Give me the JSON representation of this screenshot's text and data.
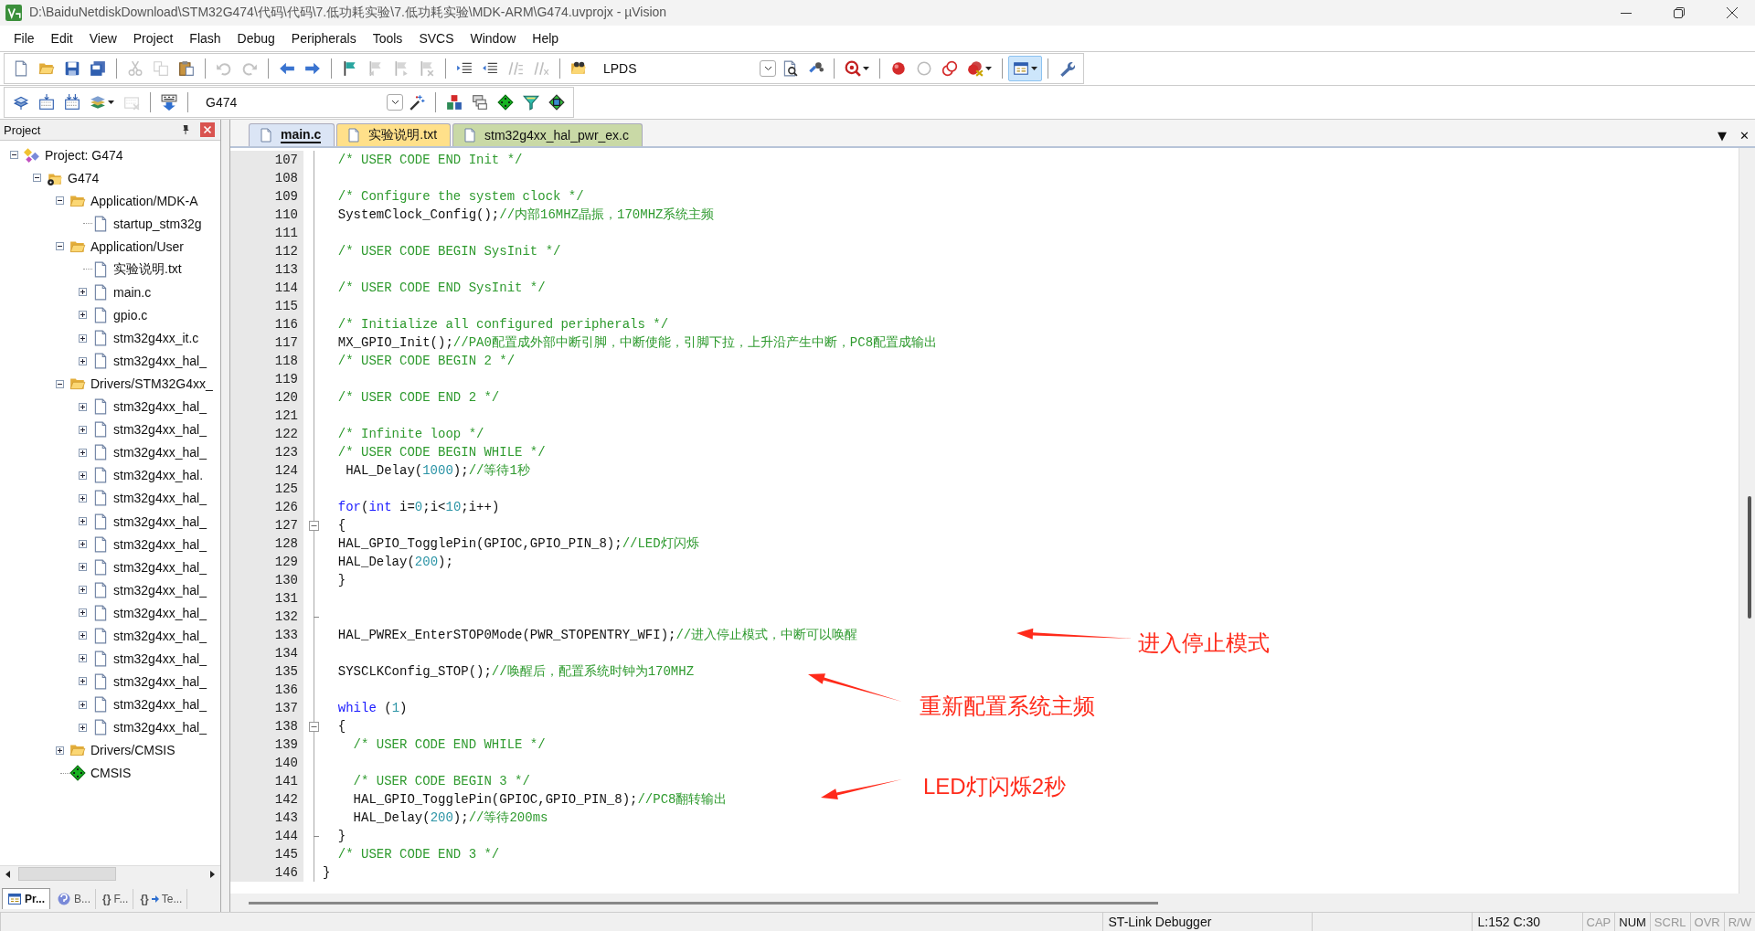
{
  "window": {
    "title": "D:\\BaiduNetdiskDownload\\STM32G474\\代码\\代码\\7.低功耗实验\\7.低功耗实验\\MDK-ARM\\G474.uvprojx - µVision"
  },
  "menu": [
    "File",
    "Edit",
    "View",
    "Project",
    "Flash",
    "Debug",
    "Peripherals",
    "Tools",
    "SVCS",
    "Window",
    "Help"
  ],
  "toolbar_1": [
    {
      "kind": "button",
      "disabled": false,
      "pressed": false
    },
    {
      "kind": "button",
      "disabled": false,
      "pressed": false
    },
    {
      "kind": "button",
      "disabled": false,
      "pressed": false
    },
    {
      "kind": "button",
      "disabled": false,
      "pressed": false
    },
    {
      "kind": "separator"
    },
    {
      "kind": "button",
      "disabled": true,
      "pressed": false
    },
    {
      "kind": "button",
      "disabled": true,
      "pressed": false
    },
    {
      "kind": "button",
      "disabled": false,
      "pressed": false
    },
    {
      "kind": "separator"
    },
    {
      "kind": "button",
      "disabled": true,
      "pressed": false
    },
    {
      "kind": "button",
      "disabled": true,
      "pressed": false
    },
    {
      "kind": "separator"
    },
    {
      "kind": "button",
      "disabled": false,
      "pressed": false
    },
    {
      "kind": "button",
      "disabled": false,
      "pressed": false
    },
    {
      "kind": "separator"
    },
    {
      "kind": "button",
      "disabled": false,
      "pressed": false
    },
    {
      "kind": "button",
      "disabled": true,
      "pressed": false
    },
    {
      "kind": "button",
      "disabled": true,
      "pressed": false
    },
    {
      "kind": "button",
      "disabled": true,
      "pressed": false
    },
    {
      "kind": "separator"
    },
    {
      "kind": "button",
      "disabled": false,
      "pressed": false
    },
    {
      "kind": "button",
      "disabled": false,
      "pressed": false
    },
    {
      "kind": "button",
      "disabled": true,
      "pressed": false
    },
    {
      "kind": "button",
      "disabled": true,
      "pressed": false
    },
    {
      "kind": "separator"
    },
    {
      "kind": "button",
      "disabled": false,
      "pressed": false
    },
    {
      "kind": "combo",
      "value": "LPDS"
    },
    {
      "kind": "button",
      "disabled": false,
      "pressed": false
    },
    {
      "kind": "button",
      "disabled": false,
      "pressed": false
    },
    {
      "kind": "separator"
    },
    {
      "kind": "button",
      "disabled": false,
      "pressed": false
    },
    {
      "kind": "separator"
    },
    {
      "kind": "button",
      "disabled": false,
      "pressed": false
    },
    {
      "kind": "button",
      "disabled": false,
      "pressed": false
    },
    {
      "kind": "button",
      "disabled": false,
      "pressed": false
    },
    {
      "kind": "button",
      "disabled": false,
      "pressed": false
    },
    {
      "kind": "separator"
    },
    {
      "kind": "button",
      "disabled": false,
      "pressed": true
    },
    {
      "kind": "separator"
    },
    {
      "kind": "button",
      "disabled": false,
      "pressed": false
    }
  ],
  "toolbar_2": [
    {
      "kind": "button",
      "disabled": false,
      "pressed": false
    },
    {
      "kind": "button",
      "disabled": false,
      "pressed": false
    },
    {
      "kind": "button",
      "disabled": false,
      "pressed": false
    },
    {
      "kind": "button",
      "disabled": false,
      "pressed": false
    },
    {
      "kind": "button",
      "disabled": true,
      "pressed": false
    },
    {
      "kind": "separator"
    },
    {
      "kind": "button",
      "disabled": false,
      "pressed": false
    },
    {
      "kind": "separator"
    },
    {
      "kind": "combo",
      "value": "G474"
    },
    {
      "kind": "button",
      "disabled": false,
      "pressed": false
    },
    {
      "kind": "separator"
    },
    {
      "kind": "button",
      "disabled": false,
      "pressed": false
    },
    {
      "kind": "button",
      "disabled": false,
      "pressed": false
    },
    {
      "kind": "button",
      "disabled": false,
      "pressed": false
    },
    {
      "kind": "button",
      "disabled": false,
      "pressed": false
    },
    {
      "kind": "button",
      "disabled": false,
      "pressed": false
    }
  ],
  "project_panel": {
    "title": "Project",
    "tree": [
      {
        "label": "Project: G474",
        "kind": "project",
        "expanded": true,
        "children": [
          {
            "label": "G474",
            "kind": "target",
            "expanded": true,
            "children": [
              {
                "label": "Application/MDK-A",
                "kind": "group",
                "expanded": true,
                "children": [
                  {
                    "label": "startup_stm32g",
                    "kind": "file"
                  }
                ]
              },
              {
                "label": "Application/User",
                "kind": "group",
                "expanded": true,
                "children": [
                  {
                    "label": "实验说明.txt",
                    "kind": "file"
                  },
                  {
                    "label": "main.c",
                    "kind": "file",
                    "expanded": false
                  },
                  {
                    "label": "gpio.c",
                    "kind": "file",
                    "expanded": false
                  },
                  {
                    "label": "stm32g4xx_it.c",
                    "kind": "file",
                    "expanded": false
                  },
                  {
                    "label": "stm32g4xx_hal_",
                    "kind": "file",
                    "expanded": false
                  }
                ]
              },
              {
                "label": "Drivers/STM32G4xx_",
                "kind": "group",
                "expanded": true,
                "children": [
                  {
                    "label": "stm32g4xx_hal_",
                    "kind": "file",
                    "expanded": false
                  },
                  {
                    "label": "stm32g4xx_hal_",
                    "kind": "file",
                    "expanded": false
                  },
                  {
                    "label": "stm32g4xx_hal_",
                    "kind": "file",
                    "expanded": false
                  },
                  {
                    "label": "stm32g4xx_hal.",
                    "kind": "file",
                    "expanded": false
                  },
                  {
                    "label": "stm32g4xx_hal_",
                    "kind": "file",
                    "expanded": false
                  },
                  {
                    "label": "stm32g4xx_hal_",
                    "kind": "file",
                    "expanded": false
                  },
                  {
                    "label": "stm32g4xx_hal_",
                    "kind": "file",
                    "expanded": false
                  },
                  {
                    "label": "stm32g4xx_hal_",
                    "kind": "file",
                    "expanded": false
                  },
                  {
                    "label": "stm32g4xx_hal_",
                    "kind": "file",
                    "expanded": false
                  },
                  {
                    "label": "stm32g4xx_hal_",
                    "kind": "file",
                    "expanded": false
                  },
                  {
                    "label": "stm32g4xx_hal_",
                    "kind": "file",
                    "expanded": false
                  },
                  {
                    "label": "stm32g4xx_hal_",
                    "kind": "file",
                    "expanded": false
                  },
                  {
                    "label": "stm32g4xx_hal_",
                    "kind": "file",
                    "expanded": false
                  },
                  {
                    "label": "stm32g4xx_hal_",
                    "kind": "file",
                    "expanded": false
                  },
                  {
                    "label": "stm32g4xx_hal_",
                    "kind": "file",
                    "expanded": false
                  }
                ]
              },
              {
                "label": "Drivers/CMSIS",
                "kind": "group",
                "expanded": false
              },
              {
                "label": "CMSIS",
                "kind": "component"
              }
            ]
          }
        ]
      }
    ],
    "tabs": [
      {
        "label": "Pr...",
        "selected": true
      },
      {
        "label": "B...",
        "selected": false
      },
      {
        "label": "F...",
        "glyph": "{}",
        "selected": false
      },
      {
        "label": "Te...",
        "glyph": "{}",
        "selected": false
      }
    ]
  },
  "editor": {
    "tabs": [
      {
        "label": "main.c",
        "selected": true,
        "color": "#dbe5f5"
      },
      {
        "label": "实验说明.txt",
        "selected": false,
        "color": "#ffe08a"
      },
      {
        "label": "stm32g4xx_hal_pwr_ex.c",
        "selected": false,
        "color": "#c9d9a6"
      }
    ],
    "tab_menu": "▼",
    "close": "✕",
    "lines": [
      {
        "number": "107",
        "kind": "line",
        "segments": [
          {
            "kind": "comment",
            "text": "  /* USER CODE END Init */"
          }
        ]
      },
      {
        "number": "108",
        "kind": "line"
      },
      {
        "number": "109",
        "kind": "line",
        "segments": [
          {
            "kind": "comment",
            "text": "  /* Configure the system clock */"
          }
        ]
      },
      {
        "number": "110",
        "kind": "line",
        "segments": [
          {
            "kind": "plain",
            "text": "  SystemClock_Config();"
          },
          {
            "kind": "comment",
            "text": "//内部16MHZ晶振，170MHZ系统主频"
          }
        ]
      },
      {
        "number": "111",
        "kind": "line"
      },
      {
        "number": "112",
        "kind": "line",
        "segments": [
          {
            "kind": "comment",
            "text": "  /* USER CODE BEGIN SysInit */"
          }
        ]
      },
      {
        "number": "113",
        "kind": "line"
      },
      {
        "number": "114",
        "kind": "line",
        "segments": [
          {
            "kind": "comment",
            "text": "  /* USER CODE END SysInit */"
          }
        ]
      },
      {
        "number": "115",
        "kind": "line"
      },
      {
        "number": "116",
        "kind": "line",
        "segments": [
          {
            "kind": "comment",
            "text": "  /* Initialize all configured peripherals */"
          }
        ]
      },
      {
        "number": "117",
        "kind": "line",
        "segments": [
          {
            "kind": "plain",
            "text": "  MX_GPIO_Init();"
          },
          {
            "kind": "comment",
            "text": "//PA0配置成外部中断引脚，中断使能，引脚下拉，上升沿产生中断，PC8配置成输出"
          }
        ]
      },
      {
        "number": "118",
        "kind": "line",
        "segments": [
          {
            "kind": "comment",
            "text": "  /* USER CODE BEGIN 2 */"
          }
        ]
      },
      {
        "number": "119",
        "kind": "line"
      },
      {
        "number": "120",
        "kind": "line",
        "segments": [
          {
            "kind": "comment",
            "text": "  /* USER CODE END 2 */"
          }
        ]
      },
      {
        "number": "121",
        "kind": "line"
      },
      {
        "number": "122",
        "kind": "line",
        "segments": [
          {
            "kind": "comment",
            "text": "  /* Infinite loop */"
          }
        ]
      },
      {
        "number": "123",
        "kind": "line",
        "segments": [
          {
            "kind": "comment",
            "text": "  /* USER CODE BEGIN WHILE */"
          }
        ]
      },
      {
        "number": "124",
        "kind": "line",
        "segments": [
          {
            "kind": "plain",
            "text": "   HAL_Delay("
          },
          {
            "kind": "number",
            "text": "1000"
          },
          {
            "kind": "plain",
            "text": ");"
          },
          {
            "kind": "comment",
            "text": "//等待1秒"
          }
        ]
      },
      {
        "number": "125",
        "kind": "line"
      },
      {
        "number": "126",
        "kind": "line",
        "segments": [
          {
            "kind": "keyword",
            "text": "  for"
          },
          {
            "kind": "plain",
            "text": "("
          },
          {
            "kind": "keyword",
            "text": "int"
          },
          {
            "kind": "plain",
            "text": " i="
          },
          {
            "kind": "number",
            "text": "0"
          },
          {
            "kind": "plain",
            "text": ";i<"
          },
          {
            "kind": "number",
            "text": "10"
          },
          {
            "kind": "plain",
            "text": ";i++)"
          }
        ]
      },
      {
        "number": "127",
        "kind": "fold_start",
        "segments": [
          {
            "kind": "plain",
            "text": "  {"
          }
        ]
      },
      {
        "number": "128",
        "kind": "line",
        "segments": [
          {
            "kind": "plain",
            "text": "  HAL_GPIO_TogglePin(GPIOC,GPIO_PIN_8);"
          },
          {
            "kind": "comment",
            "text": "//LED灯闪烁"
          }
        ]
      },
      {
        "number": "129",
        "kind": "line",
        "segments": [
          {
            "kind": "plain",
            "text": "  HAL_Delay("
          },
          {
            "kind": "number",
            "text": "200"
          },
          {
            "kind": "plain",
            "text": ");"
          }
        ]
      },
      {
        "number": "130",
        "kind": "line",
        "segments": [
          {
            "kind": "plain",
            "text": "  }"
          }
        ]
      },
      {
        "number": "131",
        "kind": "line"
      },
      {
        "number": "132",
        "kind": "fold_end"
      },
      {
        "number": "133",
        "kind": "line",
        "segments": [
          {
            "kind": "plain",
            "text": "  HAL_PWREx_EnterSTOP0Mode(PWR_STOPENTRY_WFI);"
          },
          {
            "kind": "comment",
            "text": "//进入停止模式，中断可以唤醒"
          }
        ]
      },
      {
        "number": "134",
        "kind": "line"
      },
      {
        "number": "135",
        "kind": "line",
        "segments": [
          {
            "kind": "plain",
            "text": "  SYSCLKConfig_STOP();"
          },
          {
            "kind": "comment",
            "text": "//唤醒后，配置系统时钟为170MHZ"
          }
        ]
      },
      {
        "number": "136",
        "kind": "line"
      },
      {
        "number": "137",
        "kind": "line",
        "segments": [
          {
            "kind": "keyword",
            "text": "  while"
          },
          {
            "kind": "plain",
            "text": " ("
          },
          {
            "kind": "number",
            "text": "1"
          },
          {
            "kind": "plain",
            "text": ")"
          }
        ]
      },
      {
        "number": "138",
        "kind": "fold_start",
        "segments": [
          {
            "kind": "plain",
            "text": "  {"
          }
        ]
      },
      {
        "number": "139",
        "kind": "line",
        "segments": [
          {
            "kind": "comment",
            "text": "    /* USER CODE END WHILE */"
          }
        ]
      },
      {
        "number": "140",
        "kind": "line"
      },
      {
        "number": "141",
        "kind": "line",
        "segments": [
          {
            "kind": "comment",
            "text": "    /* USER CODE BEGIN 3 */"
          }
        ]
      },
      {
        "number": "142",
        "kind": "line",
        "segments": [
          {
            "kind": "plain",
            "text": "    HAL_GPIO_TogglePin(GPIOC,GPIO_PIN_8);"
          },
          {
            "kind": "comment",
            "text": "//PC8翻转输出"
          }
        ]
      },
      {
        "number": "143",
        "kind": "line",
        "segments": [
          {
            "kind": "plain",
            "text": "    HAL_Delay("
          },
          {
            "kind": "number",
            "text": "200"
          },
          {
            "kind": "plain",
            "text": ");"
          },
          {
            "kind": "comment",
            "text": "//等待200ms"
          }
        ]
      },
      {
        "number": "144",
        "kind": "fold_end",
        "segments": [
          {
            "kind": "plain",
            "text": "  }"
          }
        ]
      },
      {
        "number": "145",
        "kind": "line",
        "segments": [
          {
            "kind": "comment",
            "text": "  /* USER CODE END 3 */"
          }
        ]
      },
      {
        "number": "146",
        "kind": "line",
        "segments": [
          {
            "kind": "plain",
            "text": "}"
          }
        ]
      }
    ]
  },
  "annotations": [
    {
      "text": "进入停止模式"
    },
    {
      "text": "重新配置系统主频"
    },
    {
      "text": "LED灯闪烁2秒"
    }
  ],
  "status_bar": {
    "debugger": "ST-Link Debugger",
    "position": "L:152 C:30",
    "indicators": [
      {
        "label": "CAP",
        "on": false
      },
      {
        "label": "NUM",
        "on": true
      },
      {
        "label": "SCRL",
        "on": false
      },
      {
        "label": "OVR",
        "on": false
      },
      {
        "label": "R/W",
        "on": false
      }
    ]
  }
}
